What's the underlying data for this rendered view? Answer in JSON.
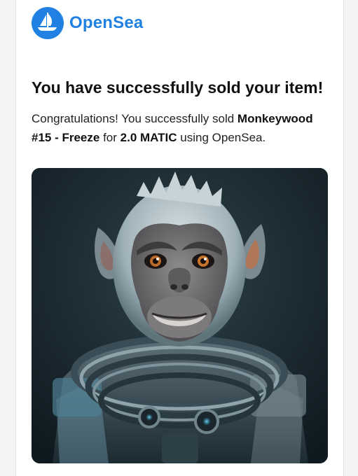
{
  "brand": {
    "name": "OpenSea",
    "logo_icon": "opensea-boat-icon",
    "color": "#2081e2"
  },
  "email": {
    "headline": "You have successfully sold your item!",
    "message": {
      "prefix": "Congratulations! You successfully sold ",
      "item_name": "Monkeywood #15 - Freeze",
      "middle": " for ",
      "price": "2.0 MATIC",
      "suffix": " using OpenSea."
    }
  },
  "nft_image": {
    "icon": "astronaut-monkey-artwork"
  }
}
